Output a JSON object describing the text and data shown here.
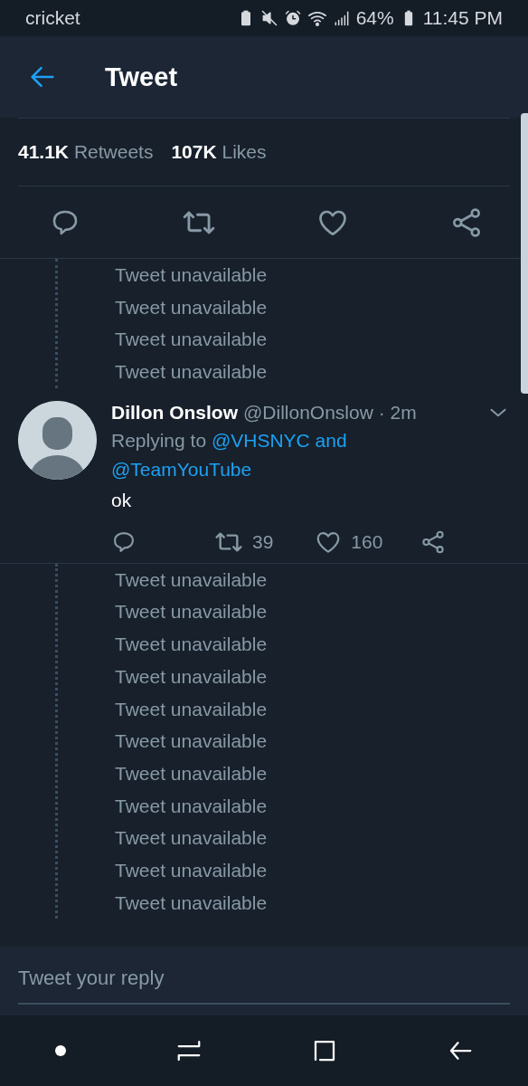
{
  "status_bar": {
    "carrier": "cricket",
    "battery_percent": "64%",
    "time": "11:45 PM"
  },
  "header": {
    "title": "Tweet"
  },
  "stats": [
    {
      "count": "41.1K",
      "label": "Retweets"
    },
    {
      "count": "107K",
      "label": "Likes"
    }
  ],
  "unavailable_before": [
    "Tweet unavailable",
    "Tweet unavailable",
    "Tweet unavailable",
    "Tweet unavailable"
  ],
  "reply": {
    "name": "Dillon Onslow",
    "handle": "@DillonOnslow",
    "time": "· 2m",
    "replying_prefix": "Replying to",
    "replying_to": [
      "@VHSNYC and",
      "@TeamYouTube"
    ],
    "text": "ok",
    "retweets": "39",
    "likes": "160"
  },
  "unavailable_after": [
    "Tweet unavailable",
    "Tweet unavailable",
    "Tweet unavailable",
    "Tweet unavailable",
    "Tweet unavailable",
    "Tweet unavailable",
    "Tweet unavailable",
    "Tweet unavailable",
    "Tweet unavailable",
    "Tweet unavailable",
    "Tweet unavailable"
  ],
  "composer": {
    "placeholder": "Tweet your reply"
  }
}
